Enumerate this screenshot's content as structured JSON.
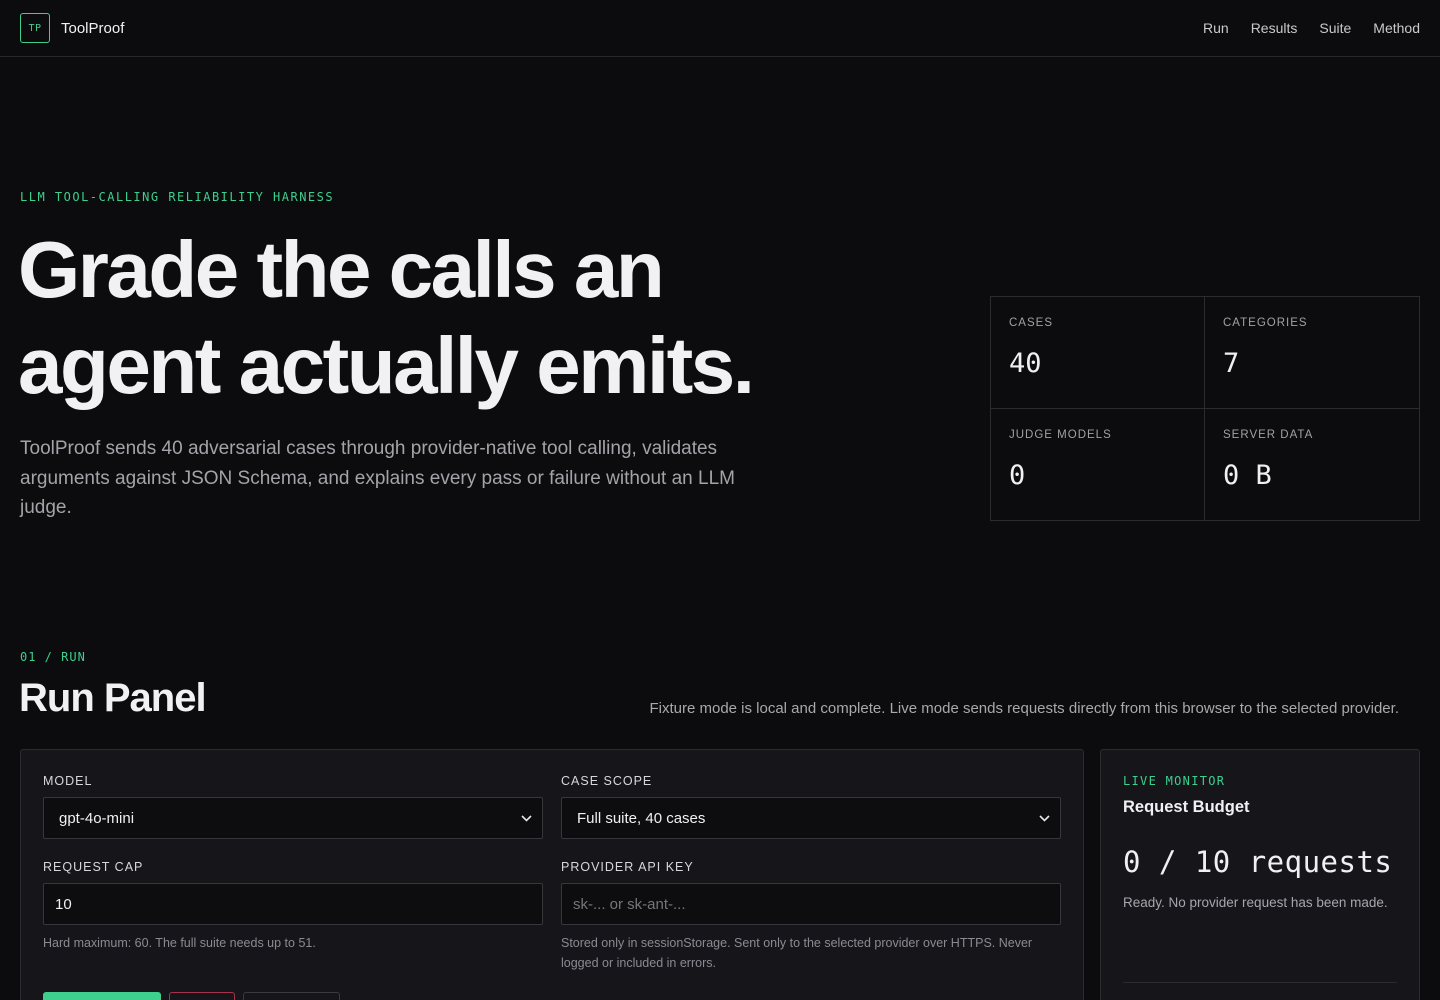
{
  "header": {
    "logo_text": "TP",
    "brand": "ToolProof",
    "nav": [
      "Run",
      "Results",
      "Suite",
      "Method"
    ]
  },
  "hero": {
    "eyebrow": "LLM TOOL-CALLING RELIABILITY HARNESS",
    "title_line1": "Grade the calls an",
    "title_line2": "agent actually emits.",
    "description": "ToolProof sends 40 adversarial cases through provider-native tool calling, validates arguments against JSON Schema, and explains every pass or failure without an LLM judge."
  },
  "stats": [
    {
      "label": "CASES",
      "value": "40"
    },
    {
      "label": "CATEGORIES",
      "value": "7"
    },
    {
      "label": "JUDGE MODELS",
      "value": "0"
    },
    {
      "label": "SERVER DATA",
      "value": "0 B"
    }
  ],
  "run": {
    "eyebrow": "01 / RUN",
    "title": "Run Panel",
    "note": "Fixture mode is local and complete. Live mode sends requests directly from this browser to the selected provider.",
    "model": {
      "label": "MODEL",
      "value": "gpt-4o-mini"
    },
    "scope": {
      "label": "CASE SCOPE",
      "value": "Full suite, 40 cases"
    },
    "cap": {
      "label": "REQUEST CAP",
      "value": "10",
      "hint": "Hard maximum: 60. The full suite needs up to 51."
    },
    "api_key": {
      "label": "PROVIDER API KEY",
      "placeholder": "sk-... or sk-ant-...",
      "hint": "Stored only in sessionStorage. Sent only to the selected provider over HTTPS. Never logged or included in errors."
    }
  },
  "monitor": {
    "eyebrow": "LIVE MONITOR",
    "title": "Request Budget",
    "count": "0 / 10 requests",
    "status": "Ready. No provider request has been made."
  },
  "colors": {
    "accent": "#3ecf8e",
    "danger": "#a8324e",
    "background": "#0c0c0e",
    "panel": "#16161a"
  }
}
